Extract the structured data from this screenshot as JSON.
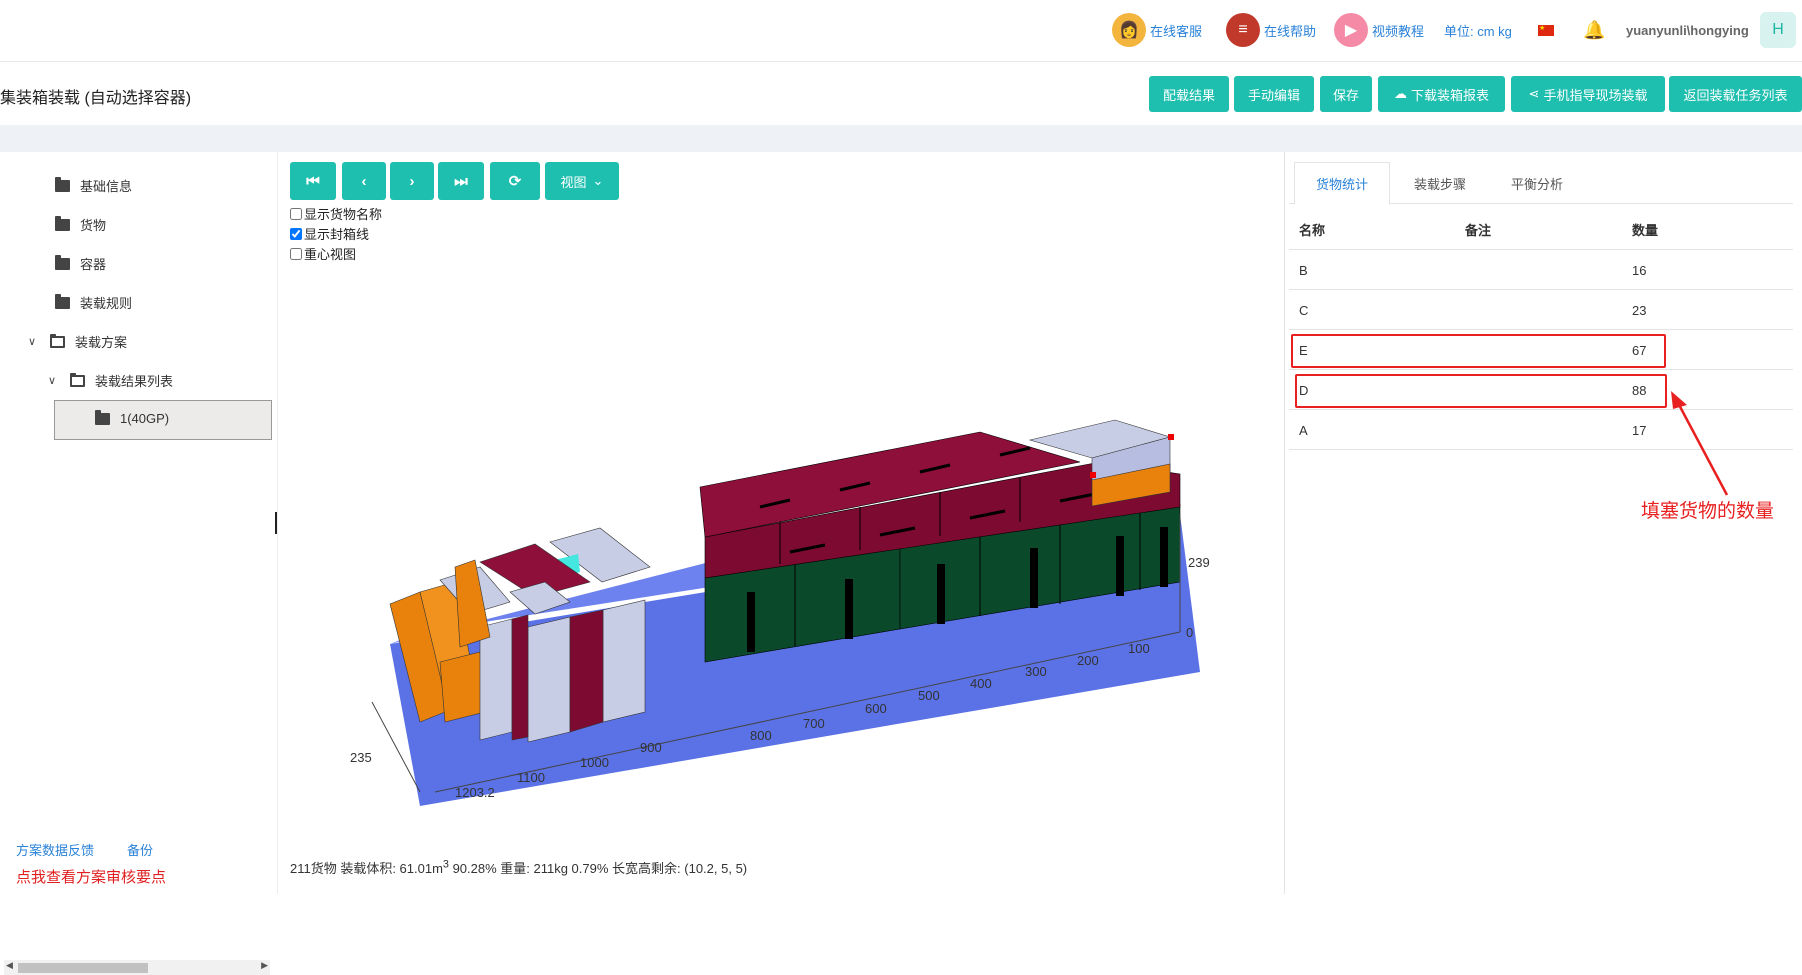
{
  "topbar": {
    "online_service": "在线客服",
    "online_help": "在线帮助",
    "video_tutorial": "视频教程",
    "unit": "单位: cm kg",
    "username": "yuanyunli\\hongying",
    "user_initial": "H"
  },
  "header": {
    "title": "集装箱装载 (自动选择容器)",
    "buttons": {
      "load_result": "配载结果",
      "manual_edit": "手动编辑",
      "save": "保存",
      "download_report": "下载装箱报表",
      "mobile_guide": "手机指导现场装载",
      "back_list": "返回装载任务列表"
    }
  },
  "sidebar": {
    "items": [
      {
        "label": "基础信息"
      },
      {
        "label": "货物"
      },
      {
        "label": "容器"
      },
      {
        "label": "装载规则"
      },
      {
        "label": "装载方案"
      },
      {
        "label": "装载结果列表"
      },
      {
        "label": "1(40GP)"
      }
    ],
    "feedback_link": "方案数据反馈",
    "backup_link": "备份",
    "audit_link": "点我查看方案审核要点"
  },
  "viewer": {
    "view_label": "视图",
    "checkboxes": [
      {
        "label": "显示货物名称",
        "checked": false
      },
      {
        "label": "显示封箱线",
        "checked": true
      },
      {
        "label": "重心视图",
        "checked": false
      }
    ],
    "axis": {
      "height_max": "239",
      "height_zero": "0",
      "width_max": "235",
      "length_ticks": [
        "100",
        "200",
        "300",
        "400",
        "500",
        "600",
        "700",
        "800",
        "900",
        "1000",
        "1100",
        "1203.2"
      ]
    },
    "status": {
      "prefix": "211货物 装载体积: 61.01m",
      "sup": "3",
      "suffix": " 90.28% 重量: 211kg 0.79% 长宽高剩余: (10.2, 5, 5)"
    }
  },
  "stats": {
    "tabs": [
      "货物统计",
      "装载步骤",
      "平衡分析"
    ],
    "columns": [
      "名称",
      "备注",
      "数量"
    ],
    "rows": [
      {
        "name": "B",
        "note": "",
        "qty": "16"
      },
      {
        "name": "C",
        "note": "",
        "qty": "23"
      },
      {
        "name": "E",
        "note": "",
        "qty": "67"
      },
      {
        "name": "D",
        "note": "",
        "qty": "88"
      },
      {
        "name": "A",
        "note": "",
        "qty": "17"
      }
    ],
    "annotation": "填塞货物的数量"
  },
  "colors": {
    "accent": "#1fbfaf",
    "link": "#2a82d8",
    "highlight": "#e82020",
    "cargo_green": "#0a4a2a",
    "cargo_red": "#7d0a30",
    "cargo_orange": "#e8820c",
    "cargo_lavender": "#c8cde6"
  }
}
